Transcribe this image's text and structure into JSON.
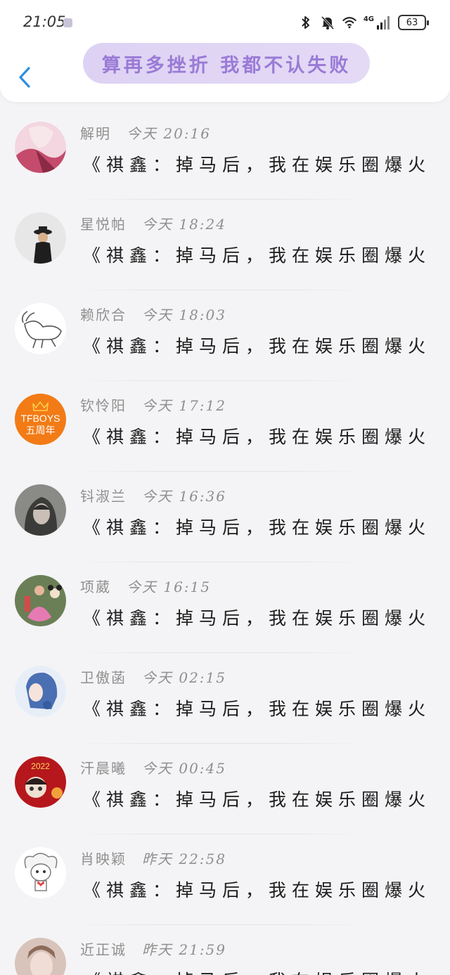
{
  "status_bar": {
    "time": "21:05",
    "network": "4G",
    "battery": "63",
    "icons": [
      "bluetooth-icon",
      "mute-bell-icon",
      "wifi-icon",
      "signal-icon"
    ]
  },
  "header": {
    "title": "算再多挫折 我都不认失败",
    "accent_color": "#9a7bd6",
    "pill_color": "#ddd2f3"
  },
  "conversations": [
    {
      "name": "解明",
      "time": "今天 20:16",
      "message": "《祺鑫：掉马后，我在娱乐圈爆火…",
      "avatar": "anime-girl-avatar"
    },
    {
      "name": "星悦帕",
      "time": "今天 18:24",
      "message": "《祺鑫：掉马后，我在娱乐圈爆火…",
      "avatar": "hat-person-avatar"
    },
    {
      "name": "赖欣合",
      "time": "今天 18:03",
      "message": "《祺鑫：掉马后，我在娱乐圈爆火…",
      "avatar": "goat-avatar"
    },
    {
      "name": "钦怜阳",
      "time": "今天 17:12",
      "message": "《祺鑫：掉马后，我在娱乐圈爆火…",
      "avatar": "tfboys-avatar",
      "avatar_text_1": "TFBOYS",
      "avatar_text_2": "五周年"
    },
    {
      "name": "钭淑兰",
      "time": "今天 16:36",
      "message": "《祺鑫：掉马后，我在娱乐圈爆火…",
      "avatar": "hooded-person-avatar"
    },
    {
      "name": "项葳",
      "time": "今天 16:15",
      "message": "《祺鑫：掉马后，我在娱乐圈爆火…",
      "avatar": "kids-mickey-avatar"
    },
    {
      "name": "卫傲菡",
      "time": "今天 02:15",
      "message": "《祺鑫：掉马后，我在娱乐圈爆火…",
      "avatar": "blue-hair-avatar"
    },
    {
      "name": "汗晨曦",
      "time": "今天 00:45",
      "message": "《祺鑫：掉马后，我在娱乐圈爆火…",
      "avatar": "new-year-2022-avatar",
      "avatar_text_1": "2022"
    },
    {
      "name": "肖映颖",
      "time": "昨天 22:58",
      "message": "《祺鑫：掉马后，我在娱乐圈爆火…",
      "avatar": "chibi-character-avatar"
    },
    {
      "name": "近正诚",
      "time": "昨天 21:59",
      "message": "《祺鑫：掉马后，我在娱乐圈爆火…",
      "avatar": "portrait-avatar"
    }
  ]
}
